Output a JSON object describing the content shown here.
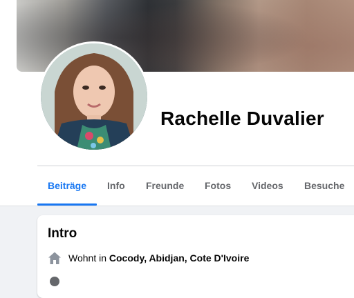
{
  "profile": {
    "name": "Rachelle Duvalier"
  },
  "tabs": [
    {
      "label": "Beiträge",
      "active": true
    },
    {
      "label": "Info"
    },
    {
      "label": "Freunde"
    },
    {
      "label": "Fotos"
    },
    {
      "label": "Videos"
    },
    {
      "label": "Besuche"
    }
  ],
  "intro": {
    "title": "Intro",
    "lives_prefix": "Wohnt in",
    "lives_place": "Cocody, Abidjan, Cote D'Ivoire",
    "lives_icon": "home-icon"
  },
  "colors": {
    "accent": "#1877f2",
    "muted_text": "#65676b",
    "background": "#f0f2f5"
  }
}
